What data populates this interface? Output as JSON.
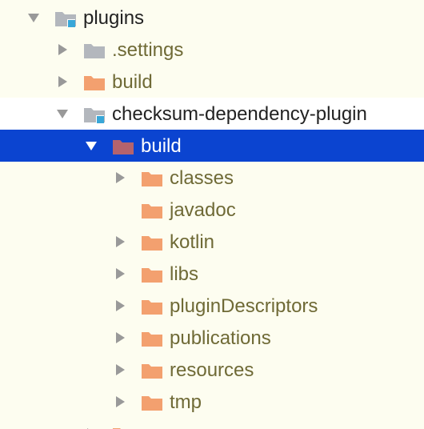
{
  "colors": {
    "background": "#fdfdf0",
    "selection": "#0b44d0",
    "folder_orange": "#f3a06f",
    "folder_gray": "#b3b7bd",
    "folder_selected": "#b4636d",
    "module_badge": "#38a7d8",
    "arrow_gray": "#999999",
    "label_olive": "#6f6a36"
  },
  "tree": {
    "items": [
      {
        "label": "plugins",
        "arrow": "expanded",
        "icon": "module-folder-icon",
        "level": 0
      },
      {
        "label": ".settings",
        "arrow": "collapsed",
        "icon": "gray-folder-icon",
        "level": 1
      },
      {
        "label": "build",
        "arrow": "collapsed",
        "icon": "orange-folder-icon",
        "level": 1
      },
      {
        "label": "checksum-dependency-plugin",
        "arrow": "expanded",
        "icon": "module-folder-icon",
        "level": 1
      },
      {
        "label": "build",
        "arrow": "expanded",
        "icon": "excluded-folder-icon",
        "level": 2,
        "selected": true
      },
      {
        "label": "classes",
        "arrow": "collapsed",
        "icon": "orange-folder-icon",
        "level": 3
      },
      {
        "label": "javadoc",
        "arrow": "none",
        "icon": "orange-folder-icon",
        "level": 3
      },
      {
        "label": "kotlin",
        "arrow": "collapsed",
        "icon": "orange-folder-icon",
        "level": 3
      },
      {
        "label": "libs",
        "arrow": "collapsed",
        "icon": "orange-folder-icon",
        "level": 3
      },
      {
        "label": "pluginDescriptors",
        "arrow": "collapsed",
        "icon": "orange-folder-icon",
        "level": 3
      },
      {
        "label": "publications",
        "arrow": "collapsed",
        "icon": "orange-folder-icon",
        "level": 3
      },
      {
        "label": "resources",
        "arrow": "collapsed",
        "icon": "orange-folder-icon",
        "level": 3
      },
      {
        "label": "tmp",
        "arrow": "collapsed",
        "icon": "orange-folder-icon",
        "level": 3
      },
      {
        "label": "",
        "arrow": "collapsed",
        "icon": "orange-folder-icon",
        "level": 2
      }
    ]
  }
}
